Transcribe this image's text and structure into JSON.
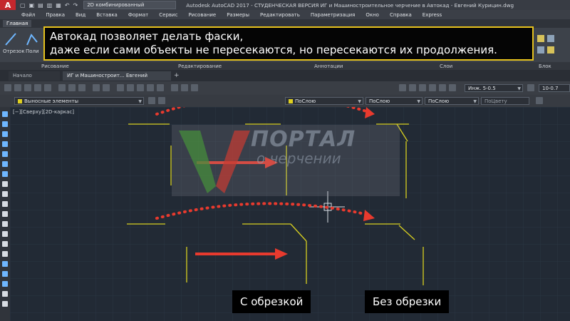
{
  "titlebar": {
    "app_logo": "A",
    "workspace": "2D комбинированный",
    "window_title": "Autodesk AutoCAD 2017 - СТУДЕНЧЕСКАЯ ВЕРСИЯ    ИГ и Машиностроительное черчение в Автокад - Евгений Курицин.dwg"
  },
  "menu": [
    "Файл",
    "Правка",
    "Вид",
    "Вставка",
    "Формат",
    "Сервис",
    "Рисование",
    "Размеры",
    "Редактировать",
    "Параметризация",
    "Окно",
    "Справка",
    "Express"
  ],
  "ribbon": {
    "active_tab": "Главная",
    "tools": {
      "tool1": "Отрезок",
      "tool2": "Поли"
    },
    "panels": [
      "Рисование",
      "Редактирование",
      "Аннотации",
      "Слои",
      "Блок"
    ]
  },
  "doc_tabs": [
    {
      "label": "Начало"
    },
    {
      "label": "ИГ и Машиностроит... Евгений Курицин*"
    }
  ],
  "toolbar": {
    "layer_dropdown": "Выносные элементы",
    "color_dropdown": "ПоСлою",
    "linetype_dropdown": "ПоСлою",
    "lineweight_dropdown": "ПоСлою",
    "plotstyle_dropdown": "ПоЦвету",
    "dim_style": "Инж. 5-0.5",
    "dim_scale": "10-0.7"
  },
  "viewport_label": "[−][Сверху][2D-каркас]",
  "overlay": {
    "line1": "Автокад позволяет делать фаски,",
    "line2": "даже если сами объекты не пересекаются, но пересекаются их продолжения."
  },
  "watermark": {
    "title": "ПОРТАЛ",
    "subtitle": "о черчении"
  },
  "captions": {
    "with_trim": "С обрезкой",
    "without_trim": "Без обрезки"
  },
  "colors": {
    "accent_yellow": "#e6c21d",
    "line_yellow": "#d8d020",
    "arrow_red": "#e83a2e"
  }
}
